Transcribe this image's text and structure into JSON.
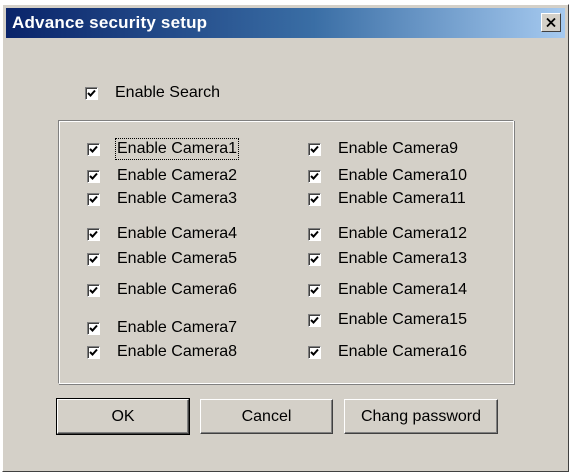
{
  "window": {
    "title": "Advance security setup",
    "close_icon": "close-icon"
  },
  "enable_search": {
    "label": "Enable Search",
    "checked": true
  },
  "cameras_left": [
    {
      "label": "Enable Camera1",
      "checked": true
    },
    {
      "label": "Enable Camera2",
      "checked": true
    },
    {
      "label": "Enable Camera3",
      "checked": true
    },
    {
      "label": "Enable Camera4",
      "checked": true
    },
    {
      "label": "Enable Camera5",
      "checked": true
    },
    {
      "label": "Enable Camera6",
      "checked": true
    },
    {
      "label": "Enable Camera7",
      "checked": true
    },
    {
      "label": "Enable Camera8",
      "checked": true
    }
  ],
  "cameras_right": [
    {
      "label": "Enable Camera9",
      "checked": true
    },
    {
      "label": "Enable Camera10",
      "checked": true
    },
    {
      "label": "Enable Camera11",
      "checked": true
    },
    {
      "label": "Enable Camera12",
      "checked": true
    },
    {
      "label": "Enable Camera13",
      "checked": true
    },
    {
      "label": "Enable Camera14",
      "checked": true
    },
    {
      "label": "Enable Camera15",
      "checked": true
    },
    {
      "label": "Enable Camera16",
      "checked": true
    }
  ],
  "buttons": {
    "ok": "OK",
    "cancel": "Cancel",
    "change_password": "Chang password"
  },
  "colors": {
    "dialog_face": "#d4d0c8",
    "title_start": "#0a246a",
    "title_end": "#a6caf0"
  }
}
